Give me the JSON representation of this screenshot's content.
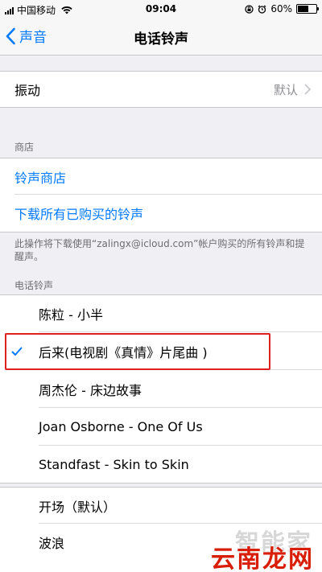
{
  "status_bar": {
    "carrier": "中国移动",
    "time": "09:04",
    "battery_percent": "60%",
    "battery_level": 0.6
  },
  "nav": {
    "back_label": "声音",
    "title": "电话铃声"
  },
  "vibration": {
    "label": "振动",
    "value": "默认"
  },
  "store_section": {
    "header": "商店",
    "items": [
      {
        "label": "铃声商店"
      },
      {
        "label": "下载所有已购买的铃声"
      }
    ],
    "footnote": "此操作将下载使用“zalingx@icloud.com”帐户购买的所有铃声和提醒声。"
  },
  "ringtones_section": {
    "header": "电话铃声",
    "items": [
      {
        "label": "陈粒 - 小半",
        "selected": false
      },
      {
        "label": "后来(电视剧《真情》片尾曲 )",
        "selected": true
      },
      {
        "label": "周杰伦 - 床边故事",
        "selected": false
      },
      {
        "label": "Joan Osborne - One Of Us",
        "selected": false
      },
      {
        "label": "Standfast - Skin to Skin",
        "selected": false
      }
    ]
  },
  "builtin_tones": {
    "items": [
      {
        "label": "开场（默认）"
      },
      {
        "label": "波浪"
      }
    ]
  },
  "watermarks": {
    "top": "智能家",
    "bottom": "云南龙网"
  },
  "colors": {
    "accent": "#007aff",
    "highlight": "#e02020",
    "background": "#efeff4"
  }
}
